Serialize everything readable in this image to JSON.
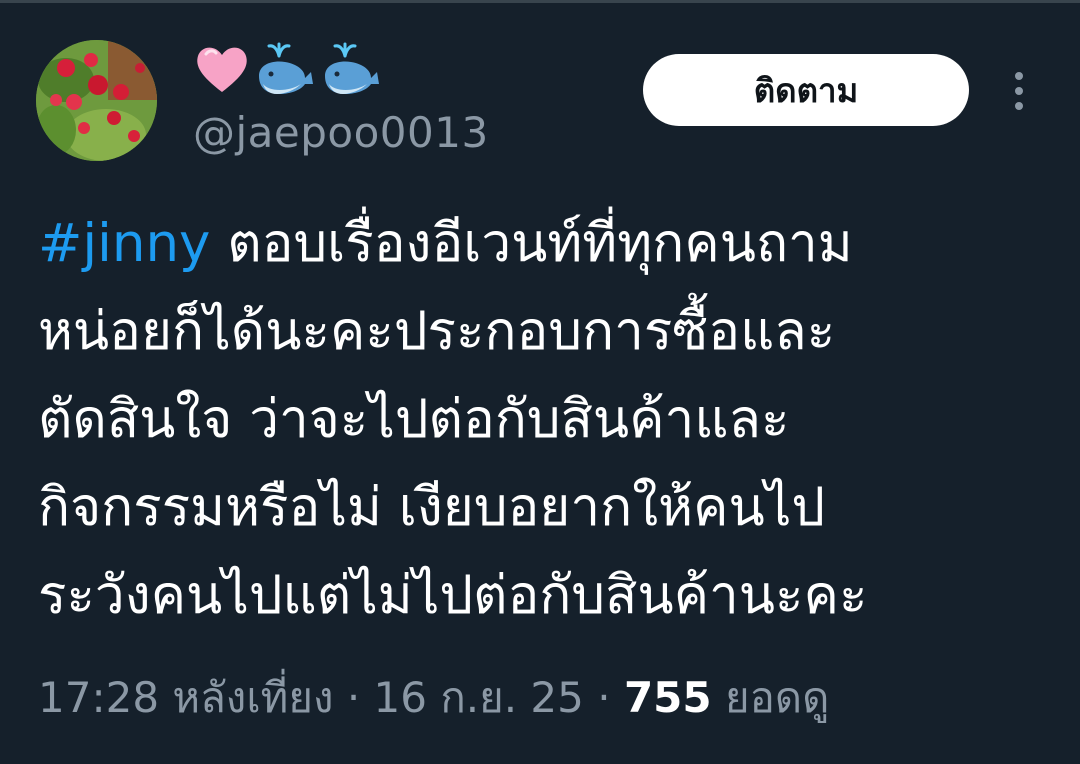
{
  "header": {
    "display_name_icons": [
      "pink-heart-icon",
      "whale-icon",
      "whale-icon"
    ],
    "handle": "@jaepoo0013",
    "follow_label": "ติดตาม",
    "more_icon": "more-vertical-icon"
  },
  "tweet": {
    "hashtag": "#jinny",
    "lines": [
      " ตอบเรื่องอีเวนท์ที่ทุกคนถาม",
      "หน่อยก็ได้นะคะประกอบการซื้อและ",
      "ตัดสินใจ ว่าจะไปต่อกับสินค้าและ",
      "กิจกรรมหรือไม่ เงียบอยากให้คนไป",
      "ระวังคนไปแต่ไม่ไปต่อกับสินค้านะคะ"
    ]
  },
  "meta": {
    "time": "17:28 หลังเที่ยง",
    "separator_1": " · ",
    "date": "16 ก.ย. 25",
    "separator_2": " · ",
    "views_count": "755",
    "views_label": " ยอดดู"
  },
  "colors": {
    "background": "#15202b",
    "hashtag": "#1d9bf0",
    "muted_text": "#8b98a5",
    "follow_button_bg": "#ffffff"
  }
}
